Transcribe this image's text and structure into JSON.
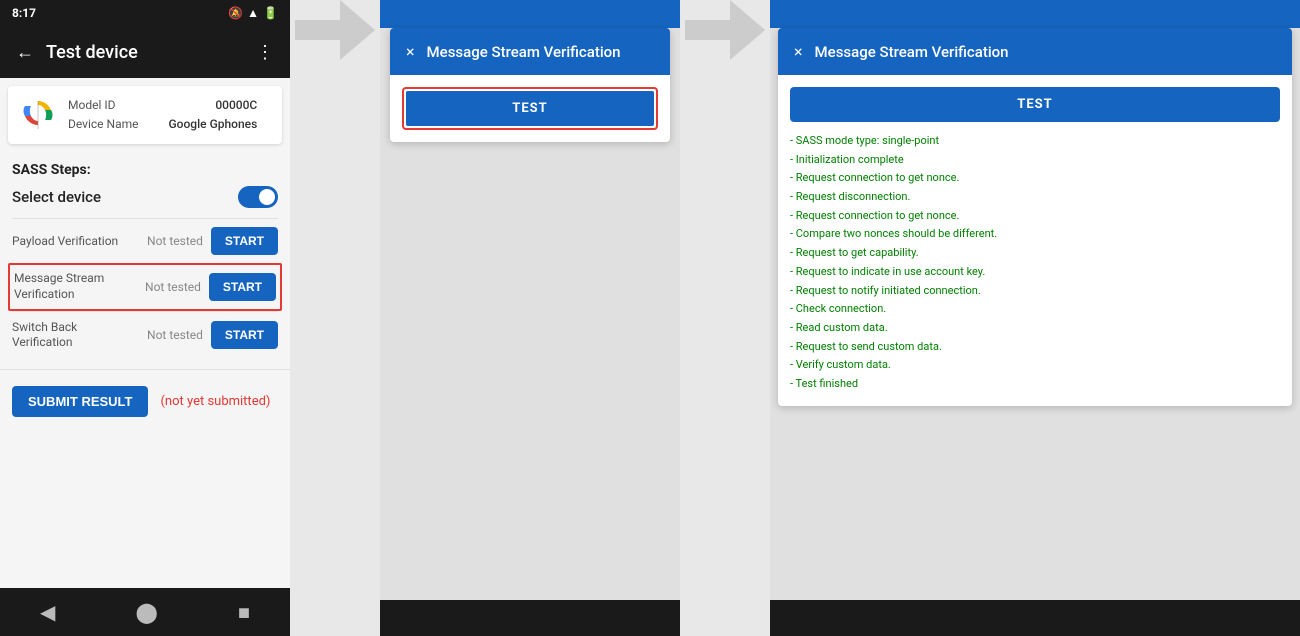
{
  "phone": {
    "status_time": "8:17",
    "app_title": "Test device",
    "model_id_label": "Model ID",
    "model_id_value": "00000C",
    "device_name_label": "Device Name",
    "device_name_value": "Google Gphones",
    "sass_title": "SASS Steps:",
    "select_device_label": "Select device",
    "steps": [
      {
        "label": "Payload Verification",
        "status": "Not tested",
        "btn": "START"
      },
      {
        "label": "Message Stream Verification",
        "status": "Not tested",
        "btn": "START",
        "highlighted": true
      },
      {
        "label": "Switch Back Verification",
        "status": "Not tested",
        "btn": "START"
      }
    ],
    "submit_btn": "SUBMIT RESULT",
    "not_submitted": "(not yet submitted)"
  },
  "dialog1": {
    "title": "Message Stream Verification",
    "test_btn": "TEST",
    "close_icon": "×"
  },
  "dialog2": {
    "title": "Message Stream Verification",
    "test_btn": "TEST",
    "close_icon": "×",
    "results": [
      "- SASS mode type: single-point",
      "- Initialization complete",
      "- Request connection to get nonce.",
      "- Request disconnection.",
      "- Request connection to get nonce.",
      "- Compare two nonces should be different.",
      "- Request to get capability.",
      "- Request to indicate in use account key.",
      "- Request to notify initiated connection.",
      "- Check connection.",
      "- Read custom data.",
      "- Request to send custom data.",
      "- Verify custom data.",
      "- Test finished"
    ]
  }
}
